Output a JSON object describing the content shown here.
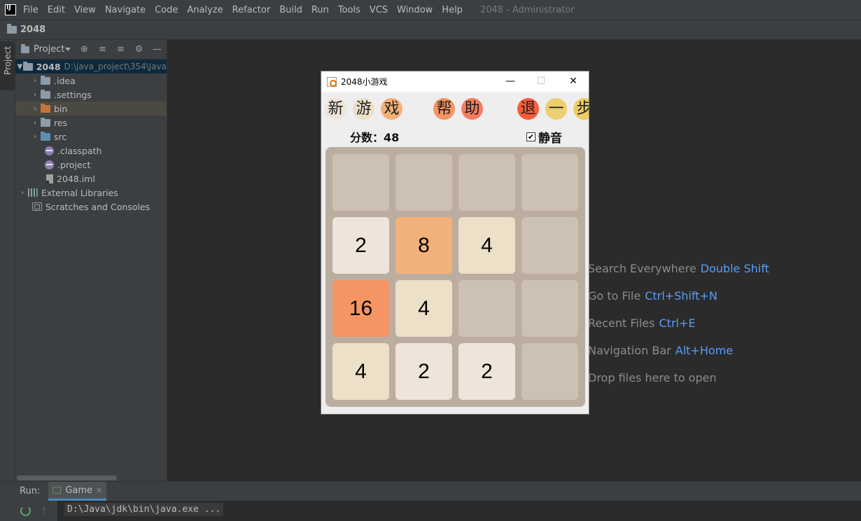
{
  "menu": {
    "items": [
      "File",
      "Edit",
      "View",
      "Navigate",
      "Code",
      "Analyze",
      "Refactor",
      "Build",
      "Run",
      "Tools",
      "VCS",
      "Window",
      "Help"
    ],
    "window_title": "2048 - Administrator"
  },
  "breadcrumb": "2048",
  "left_stripe_tab": "Project",
  "project_panel": {
    "title": "Project",
    "tree": [
      {
        "label": "2048",
        "path": "D:\\java_project\\354\\Java",
        "icon": "folder-icon"
      },
      {
        "label": ".idea",
        "icon": "folder-icon"
      },
      {
        "label": ".settings",
        "icon": "folder-icon"
      },
      {
        "label": "bin",
        "icon": "orange-folder-icon"
      },
      {
        "label": "res",
        "icon": "folder-icon"
      },
      {
        "label": "src",
        "icon": "source-folder-icon"
      },
      {
        "label": ".classpath",
        "icon": "classpath-file-icon"
      },
      {
        "label": ".project",
        "icon": "classpath-file-icon"
      },
      {
        "label": "2048.iml",
        "icon": "iml-file-icon"
      },
      {
        "label": "External Libraries",
        "icon": "library-icon"
      },
      {
        "label": "Scratches and Consoles",
        "icon": "scratches-icon"
      }
    ]
  },
  "editor_hints": [
    {
      "text": "Search Everywhere",
      "key": "Double Shift"
    },
    {
      "text": "Go to File",
      "key": "Ctrl+Shift+N"
    },
    {
      "text": "Recent Files",
      "key": "Ctrl+E"
    },
    {
      "text": "Navigation Bar",
      "key": "Alt+Home"
    },
    {
      "text": "Drop files here to open",
      "key": ""
    }
  ],
  "run_panel": {
    "label": "Run:",
    "tab": "Game",
    "command": "D:\\Java\\jdk\\bin\\java.exe ..."
  },
  "game": {
    "title": "2048小游戏",
    "buttons": [
      {
        "char": "新",
        "color": "#eee4da"
      },
      {
        "char": "游",
        "color": "#ede0c8"
      },
      {
        "char": "戏",
        "color": "#f2b179"
      },
      {
        "char": "帮",
        "color": "#f59563"
      },
      {
        "char": "助",
        "color": "#f67c5f"
      },
      {
        "char": "退",
        "color": "#f65e3b"
      },
      {
        "char": "一",
        "color": "#edcf72"
      },
      {
        "char": "步",
        "color": "#edcc61"
      }
    ],
    "score_text": "分数：48",
    "mute_checked": true,
    "mute_label": "静音",
    "board": [
      [
        null,
        null,
        null,
        null
      ],
      [
        2,
        8,
        4,
        null
      ],
      [
        16,
        4,
        null,
        null
      ],
      [
        4,
        2,
        2,
        null
      ]
    ],
    "tile_colors": {
      "empty": "#cdc1b4",
      "2": "#eee4da",
      "4": "#ede0c8",
      "8": "#f2b179",
      "16": "#f59563"
    }
  }
}
